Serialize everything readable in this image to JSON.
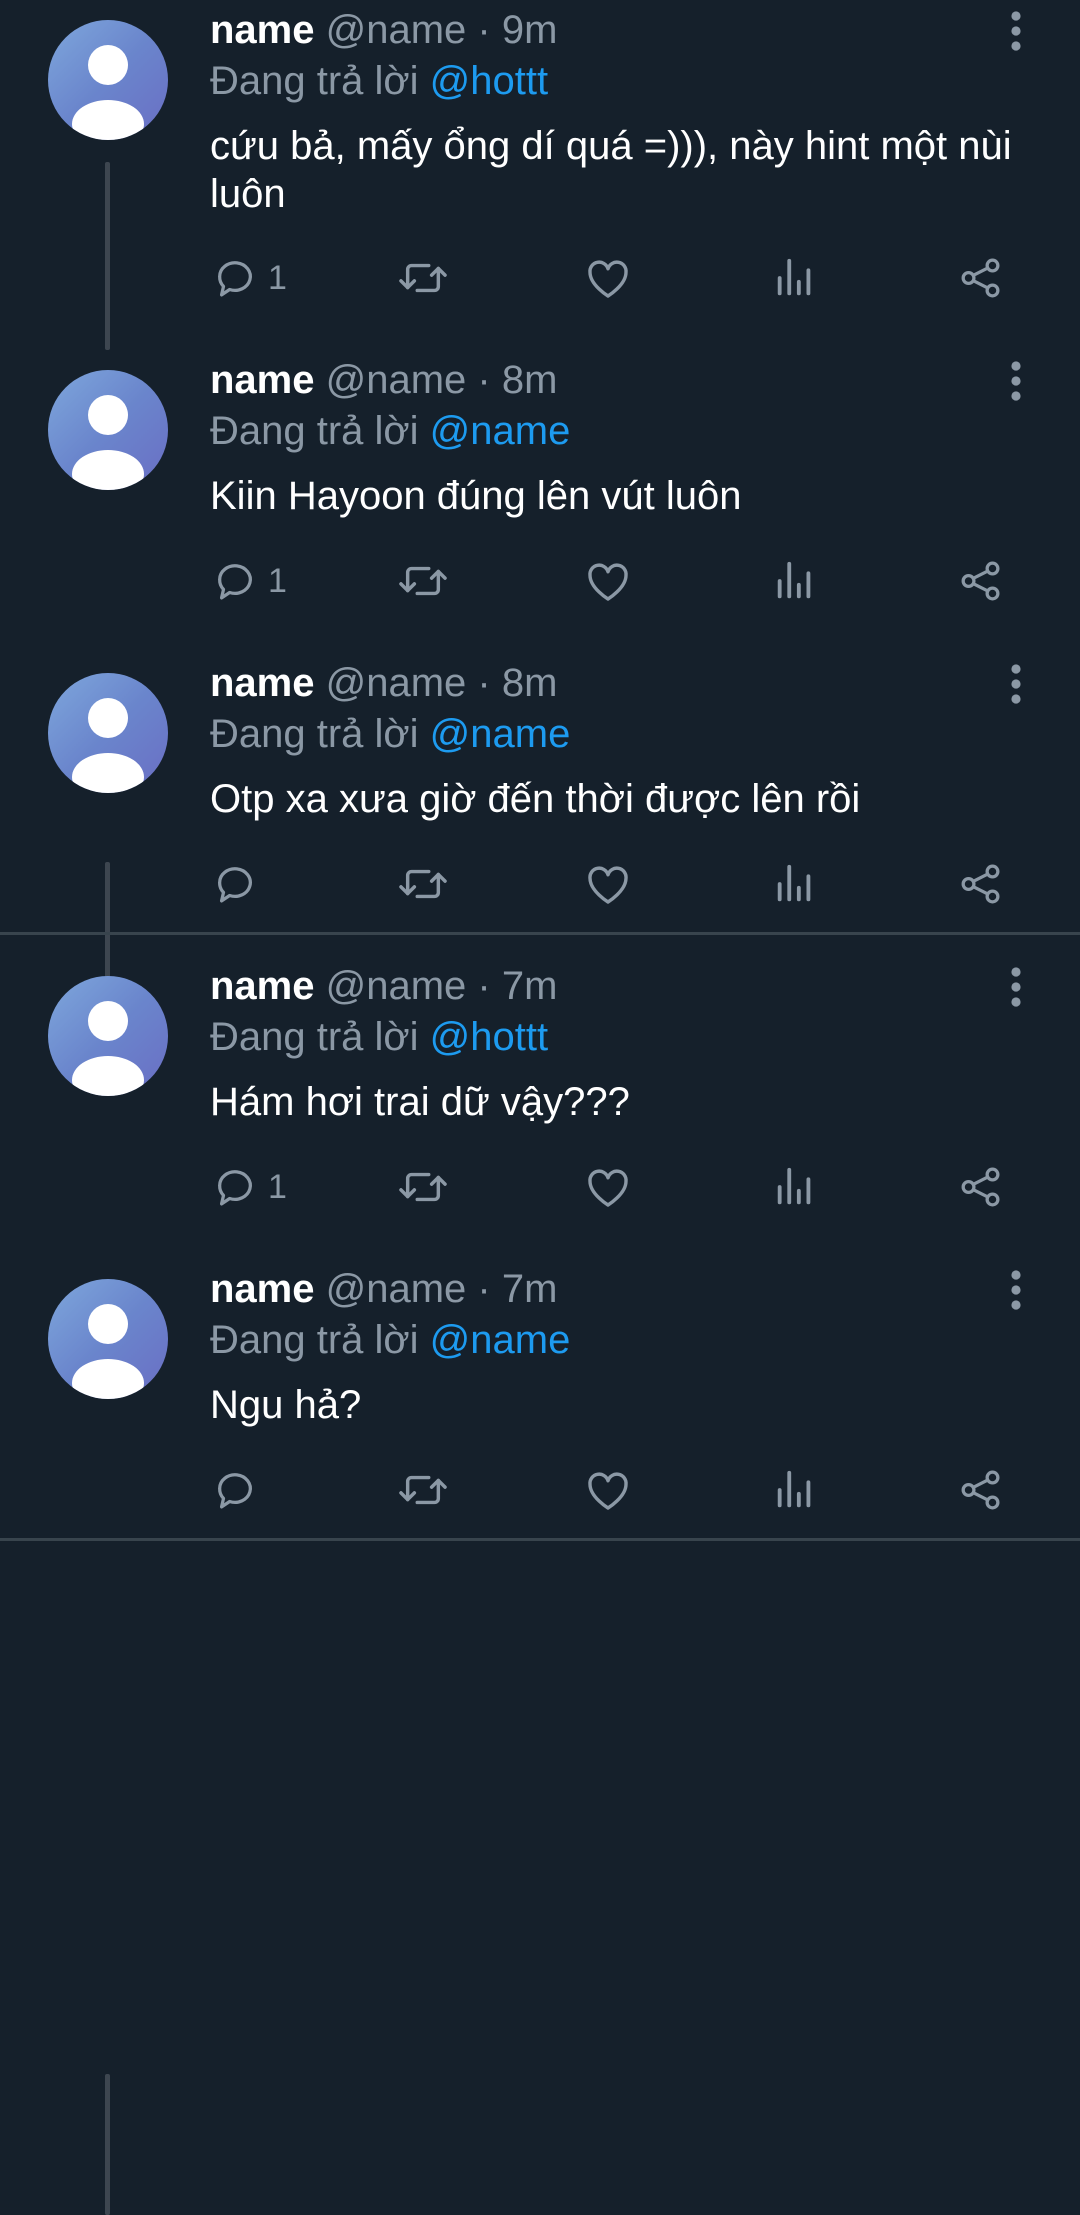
{
  "tweets": [
    {
      "author": "name",
      "handle": "@name",
      "separator": "·",
      "time": "9m",
      "replying_prefix": "Đang trả lời",
      "replying_to": "@hottt",
      "text": "cứu bả, mấy ổng dí quá =))), này hint một nùi luôn",
      "reply_count": "1"
    },
    {
      "author": "name",
      "handle": "@name",
      "separator": "·",
      "time": "8m",
      "replying_prefix": "Đang trả lời",
      "replying_to": "@name",
      "text": "Kiin Hayoon đúng lên vút luôn",
      "reply_count": "1"
    },
    {
      "author": "name",
      "handle": "@name",
      "separator": "·",
      "time": "8m",
      "replying_prefix": "Đang trả lời",
      "replying_to": "@name",
      "text": "Otp xa xưa giờ đến thời được lên rồi",
      "reply_count": ""
    },
    {
      "author": "name",
      "handle": "@name",
      "separator": "·",
      "time": "7m",
      "replying_prefix": "Đang trả lời",
      "replying_to": "@hottt",
      "text": "Hám hơi trai dữ vậy???",
      "reply_count": "1"
    },
    {
      "author": "name",
      "handle": "@name",
      "separator": "·",
      "time": "7m",
      "replying_prefix": "Đang trả lời",
      "replying_to": "@name",
      "text": "Ngu hả?",
      "reply_count": ""
    }
  ],
  "icons": {
    "reply": "reply-icon",
    "retweet": "retweet-icon",
    "like": "heart-icon",
    "views": "views-icon",
    "share": "share-icon",
    "more": "more-vertical-icon",
    "avatar": "default-avatar-icon"
  },
  "colors": {
    "background": "#15202b",
    "text_primary": "#ffffff",
    "text_secondary": "#8b98a5",
    "mention": "#1d9bf0",
    "thread_line": "#3d4650",
    "divider": "#38444d"
  }
}
